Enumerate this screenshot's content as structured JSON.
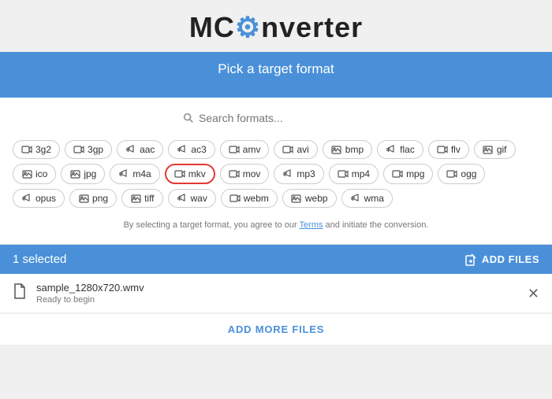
{
  "header": {
    "title_part1": "MC",
    "title_gear": "⚙",
    "title_part2": "nverter"
  },
  "format_panel": {
    "title": "Pick a target format",
    "search_placeholder": "Search formats..."
  },
  "formats": [
    {
      "id": "3g2",
      "label": "3g2",
      "type": "video"
    },
    {
      "id": "3gp",
      "label": "3gp",
      "type": "video"
    },
    {
      "id": "aac",
      "label": "aac",
      "type": "audio"
    },
    {
      "id": "ac3",
      "label": "ac3",
      "type": "audio"
    },
    {
      "id": "amv",
      "label": "amv",
      "type": "video"
    },
    {
      "id": "avi",
      "label": "avi",
      "type": "video"
    },
    {
      "id": "bmp",
      "label": "bmp",
      "type": "image"
    },
    {
      "id": "flac",
      "label": "flac",
      "type": "audio"
    },
    {
      "id": "flv",
      "label": "flv",
      "type": "video"
    },
    {
      "id": "gif",
      "label": "gif",
      "type": "image"
    },
    {
      "id": "ico",
      "label": "ico",
      "type": "image"
    },
    {
      "id": "jpg",
      "label": "jpg",
      "type": "image"
    },
    {
      "id": "m4a",
      "label": "m4a",
      "type": "audio"
    },
    {
      "id": "mkv",
      "label": "mkv",
      "type": "video",
      "selected": true
    },
    {
      "id": "mov",
      "label": "mov",
      "type": "video"
    },
    {
      "id": "mp3",
      "label": "mp3",
      "type": "audio"
    },
    {
      "id": "mp4",
      "label": "mp4",
      "type": "video"
    },
    {
      "id": "mpg",
      "label": "mpg",
      "type": "video"
    },
    {
      "id": "ogg",
      "label": "ogg",
      "type": "video"
    },
    {
      "id": "opus",
      "label": "opus",
      "type": "audio"
    },
    {
      "id": "png",
      "label": "png",
      "type": "image"
    },
    {
      "id": "tiff",
      "label": "tiff",
      "type": "image"
    },
    {
      "id": "wav",
      "label": "wav",
      "type": "audio"
    },
    {
      "id": "webm",
      "label": "webm",
      "type": "video"
    },
    {
      "id": "webp",
      "label": "webp",
      "type": "image"
    },
    {
      "id": "wma",
      "label": "wma",
      "type": "audio"
    }
  ],
  "terms": {
    "prefix": "By selecting a target format, you agree to our ",
    "link_text": "Terms",
    "suffix": " and initiate the conversion."
  },
  "files_section": {
    "selected_count": "1 selected",
    "add_files_label": "ADD FILES"
  },
  "file": {
    "name": "sample_1280x720.wmv",
    "status": "Ready to begin"
  },
  "add_more_label": "ADD MORE FILES"
}
